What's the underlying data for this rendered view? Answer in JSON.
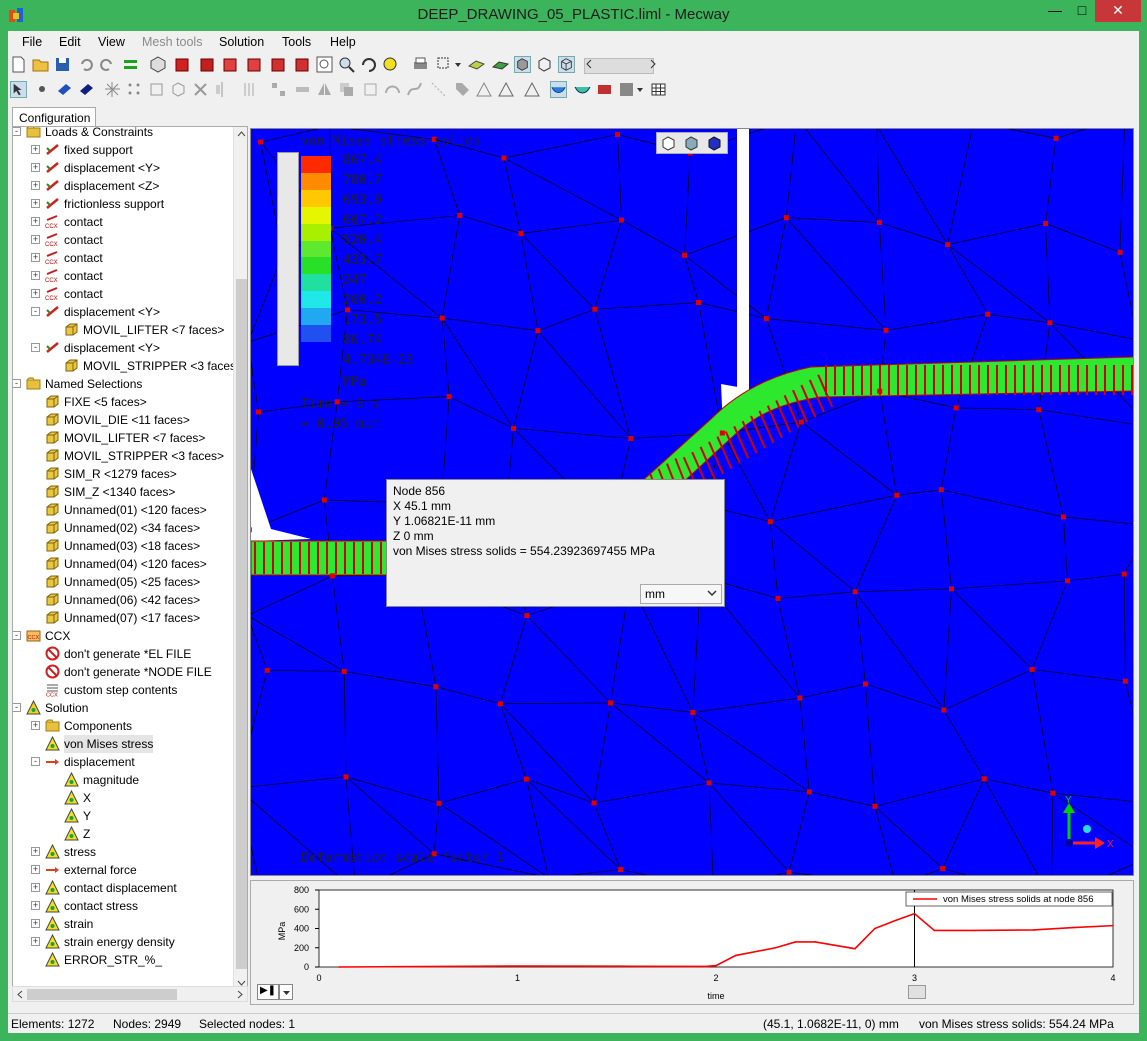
{
  "window": {
    "title": "DEEP_DRAWING_05_PLASTIC.liml - Mecway"
  },
  "menu": [
    "File",
    "Edit",
    "View",
    "Mesh tools",
    "Solution",
    "Tools",
    "Help"
  ],
  "tabs": {
    "configuration": "Configuration"
  },
  "tree": [
    {
      "label": "Loads & Constraints",
      "icon": "folder-icon"
    },
    {
      "label": "fixed support",
      "icon": "constraint-icon"
    },
    {
      "label": "displacement <Y>",
      "icon": "constraint-icon"
    },
    {
      "label": "displacement <Z>",
      "icon": "constraint-icon"
    },
    {
      "label": "frictionless support",
      "icon": "constraint-icon"
    },
    {
      "label": "contact",
      "icon": "ccx-contact-icon"
    },
    {
      "label": "contact",
      "icon": "ccx-contact-icon"
    },
    {
      "label": "contact",
      "icon": "ccx-contact-icon"
    },
    {
      "label": "contact",
      "icon": "ccx-contact-icon"
    },
    {
      "label": "contact",
      "icon": "ccx-contact-icon"
    },
    {
      "label": "displacement <Y>",
      "icon": "constraint-icon"
    },
    {
      "label": "MOVIL_LIFTER <7 faces>",
      "icon": "faces-icon"
    },
    {
      "label": "displacement <Y>",
      "icon": "constraint-icon"
    },
    {
      "label": "MOVIL_STRIPPER <3 faces>",
      "icon": "faces-icon"
    },
    {
      "label": "Named Selections",
      "icon": "folder-icon"
    },
    {
      "label": "FIXE <5 faces>",
      "icon": "faces-icon"
    },
    {
      "label": "MOVIL_DIE <11 faces>",
      "icon": "faces-icon"
    },
    {
      "label": "MOVIL_LIFTER <7 faces>",
      "icon": "faces-icon"
    },
    {
      "label": "MOVIL_STRIPPER <3 faces>",
      "icon": "faces-icon"
    },
    {
      "label": "SIM_R <1279 faces>",
      "icon": "faces-icon"
    },
    {
      "label": "SIM_Z <1340 faces>",
      "icon": "faces-icon"
    },
    {
      "label": "Unnamed(01) <120 faces>",
      "icon": "faces-icon"
    },
    {
      "label": "Unnamed(02) <34 faces>",
      "icon": "faces-icon"
    },
    {
      "label": "Unnamed(03) <18 faces>",
      "icon": "faces-icon"
    },
    {
      "label": "Unnamed(04) <120 faces>",
      "icon": "faces-icon"
    },
    {
      "label": "Unnamed(05) <25 faces>",
      "icon": "faces-icon"
    },
    {
      "label": "Unnamed(06) <42 faces>",
      "icon": "faces-icon"
    },
    {
      "label": "Unnamed(07) <17 faces>",
      "icon": "faces-icon"
    },
    {
      "label": "CCX",
      "icon": "ccx-folder-icon"
    },
    {
      "label": "don't generate *EL FILE",
      "icon": "no-file-icon"
    },
    {
      "label": "don't generate *NODE FILE",
      "icon": "no-file-icon"
    },
    {
      "label": "custom step contents",
      "icon": "custom-step-icon"
    },
    {
      "label": "Solution",
      "icon": "solution-icon"
    },
    {
      "label": "Components",
      "icon": "folder-icon"
    },
    {
      "label": "von Mises stress",
      "icon": "result-icon"
    },
    {
      "label": "displacement",
      "icon": "displacement-icon"
    },
    {
      "label": "magnitude",
      "icon": "result-icon"
    },
    {
      "label": "X",
      "icon": "result-icon"
    },
    {
      "label": "Y",
      "icon": "result-icon"
    },
    {
      "label": "Z",
      "icon": "result-icon"
    },
    {
      "label": "stress",
      "icon": "result-icon"
    },
    {
      "label": "external force",
      "icon": "force-icon"
    },
    {
      "label": "contact displacement",
      "icon": "result-icon"
    },
    {
      "label": "contact stress",
      "icon": "result-icon"
    },
    {
      "label": "strain",
      "icon": "result-icon"
    },
    {
      "label": "strain energy density",
      "icon": "result-icon"
    },
    {
      "label": "ERROR_STR_%_",
      "icon": "result-icon"
    }
  ],
  "viewport": {
    "result_title": "von Mises stress solids",
    "legend_values": [
      "867.4",
      "780.7",
      "693.9",
      "607.2",
      "520.4",
      "433.7",
      "347",
      "260.2",
      "173.5",
      "86.74",
      "4.734E-23"
    ],
    "legend_colors": [
      "#ff2a00",
      "#ff8c00",
      "#ffc800",
      "#e6f500",
      "#a8f000",
      "#5ee830",
      "#28e028",
      "#20e0a0",
      "#20e8e8",
      "#20a8f0",
      "#2050f0"
    ],
    "legend_unit": "MPa",
    "time_line1": "Time = 3 s",
    "time_line2": "= 0.05 min",
    "deformation": "Deformation scale factor 1"
  },
  "popup": {
    "node": "Node 856",
    "x": "X 45.1 mm",
    "y": "Y 1.06821E-11 mm",
    "z": "Z 0 mm",
    "value": "von Mises stress solids = 554.23923697455 MPa",
    "unit_option": "mm"
  },
  "plot": {
    "ylabel": "MPa",
    "xlabel": "time",
    "legend": "von Mises stress solids at node 856"
  },
  "chart_data": {
    "type": "line",
    "title": "",
    "xlabel": "time",
    "ylabel": "MPa",
    "xlim": [
      0,
      4
    ],
    "ylim": [
      0,
      800
    ],
    "x_ticks": [
      "0",
      "1",
      "2",
      "3",
      "4"
    ],
    "y_ticks": [
      "0",
      "200",
      "400",
      "600",
      "800"
    ],
    "legend_position": "top-right",
    "series": [
      {
        "name": "von Mises stress solids at node 856",
        "color": "#ff0000",
        "x": [
          0.1,
          0.5,
          1.0,
          1.5,
          1.95,
          2.0,
          2.1,
          2.3,
          2.4,
          2.5,
          2.7,
          2.8,
          2.9,
          3.0,
          3.1,
          3.3,
          3.6,
          3.8,
          4.0
        ],
        "y": [
          0,
          5,
          10,
          8,
          6,
          15,
          120,
          200,
          260,
          260,
          190,
          400,
          480,
          554,
          380,
          380,
          385,
          410,
          430
        ]
      }
    ]
  },
  "status": {
    "elements": "Elements: 1272",
    "nodes": "Nodes: 2949",
    "selected": "Selected nodes: 1",
    "coords": "(45.1, 1.0682E-11, 0) mm",
    "value": "von Mises stress solids: 554.24 MPa"
  }
}
